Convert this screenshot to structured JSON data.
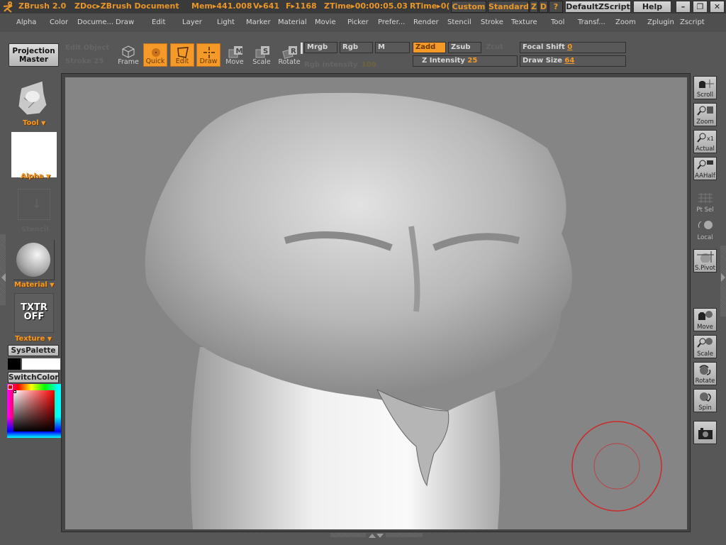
{
  "titlebar": {
    "app": "ZBrush 2.0",
    "document": "ZDoc▸ZBrush Document",
    "mem": "Mem▸441.008",
    "verts": "V▸641",
    "faces": "F▸1168",
    "ztime": "ZTime▸00:00:05.03",
    "rtime": "RTime▸0(",
    "buttons": {
      "custom": "Custom",
      "standard": "Standard",
      "z": "Z",
      "d": "D",
      "help_q": "?",
      "script": "DefaultZScript",
      "help": "Help"
    },
    "window_controls": {
      "minimize": "–",
      "restore": "❐",
      "close": "✕"
    }
  },
  "menu": [
    "Alpha",
    "Color",
    "Docume...",
    "Draw",
    "Edit",
    "Layer",
    "Light",
    "Marker",
    "Material",
    "Movie",
    "Picker",
    "Prefer...",
    "Render",
    "Stencil",
    "Stroke",
    "Texture",
    "Tool",
    "Transf...",
    "Zoom",
    "Zplugin",
    "Zscript"
  ],
  "toolbar": {
    "projection_master": [
      "Projection",
      "Master"
    ],
    "disabled_left": {
      "top": "Edit Object",
      "bottom": "Stroke 25"
    },
    "tools": [
      {
        "label": "Frame",
        "active": false
      },
      {
        "label": "Quick",
        "active": true
      },
      {
        "label": "Edit",
        "active": true
      },
      {
        "label": "Draw",
        "active": true
      },
      {
        "label": "Move",
        "active": false,
        "key": "M"
      },
      {
        "label": "Scale",
        "active": false,
        "key": "S"
      },
      {
        "label": "Rotate",
        "active": false,
        "key": "R"
      }
    ],
    "modes": {
      "mrgb": "Mrgb",
      "rgb": "Rgb",
      "m": "M",
      "zadd": "Zadd",
      "zsub": "Zsub",
      "zcut": "Zcut"
    },
    "rgb_intensity": {
      "label": "Rgb Intensity",
      "value": "100"
    },
    "z_intensity": {
      "label": "Z Intensity",
      "value": "25"
    },
    "focal_shift": {
      "label": "Focal Shift",
      "value": "0"
    },
    "draw_size": {
      "label": "Draw Size",
      "value": "64"
    }
  },
  "leftpanel": {
    "tool_label": "Tool",
    "alpha_label": "Alpha",
    "stencil_label": "Stencil",
    "material_label": "Material",
    "texture_thumb": [
      "TXTR",
      "OFF"
    ],
    "texture_label": "Texture",
    "syspalette": "SysPalette",
    "switchcolor": "SwitchColor",
    "colors": {
      "primary": "#000000",
      "secondary": "#ffffff"
    }
  },
  "rightpanel": {
    "items": [
      "Scroll",
      "Zoom",
      "Actual",
      "AAHalf",
      "Pt Sel",
      "Local",
      "S.Pivot",
      "Move",
      "Scale",
      "Rotate",
      "Spin",
      ""
    ]
  },
  "colors": {
    "accent": "#f59a28",
    "brush_cursor": "#cc2a2a",
    "canvas": "#858585"
  }
}
